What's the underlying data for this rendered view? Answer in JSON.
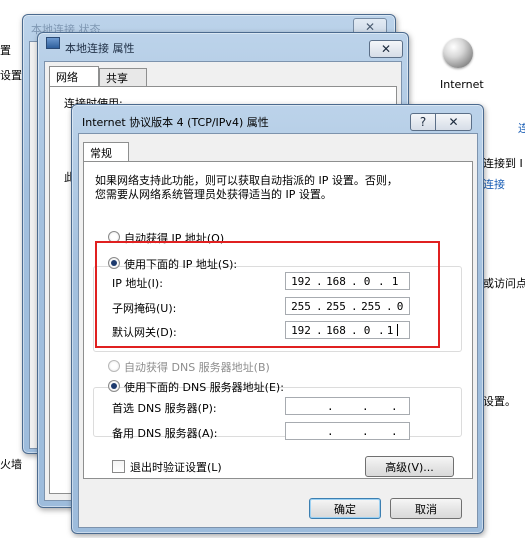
{
  "background": {
    "left_items": [
      "置",
      "设置"
    ],
    "firewall_text": "火墙",
    "internet_label": "Internet",
    "right_link_top": "连",
    "connect_to_text": "连接到 I",
    "connect_link": "连接",
    "or_visit_text": "或访问点",
    "settings_text": "设置。"
  },
  "back_window": {
    "title": "本地连接 状态",
    "close_label": "✕"
  },
  "mid_window": {
    "title": "本地连接 属性",
    "close_label": "✕",
    "tabs": [
      "网络",
      "共享"
    ],
    "connect_using_label": "连接时使用:",
    "side_label": "此"
  },
  "front_window": {
    "title": "Internet 协议版本 4 (TCP/IPv4) 属性",
    "help_label": "?",
    "close_label": "✕",
    "tab_general": "常规",
    "description_line1": "如果网络支持此功能，则可以获取自动指派的 IP 设置。否则，",
    "description_line2": "您需要从网络系统管理员处获得适当的 IP 设置。",
    "auto_ip_label": "自动获得 IP 地址(O)",
    "manual_ip_label": "使用下面的 IP 地址(S):",
    "ip_address_label": "IP 地址(I):",
    "subnet_label": "子网掩码(U):",
    "gateway_label": "默认网关(D):",
    "ip_address": [
      "192",
      "168",
      "0",
      "1"
    ],
    "subnet_mask": [
      "255",
      "255",
      "255",
      "0"
    ],
    "gateway": [
      "192",
      "168",
      "0",
      "1"
    ],
    "auto_dns_label": "自动获得 DNS 服务器地址(B)",
    "manual_dns_label": "使用下面的 DNS 服务器地址(E):",
    "preferred_dns_label": "首选 DNS 服务器(P):",
    "alternate_dns_label": "备用 DNS 服务器(A):",
    "dot": ".",
    "validate_label": "退出时验证设置(L)",
    "advanced_button": "高级(V)...",
    "ok_button": "确定",
    "cancel_button": "取消"
  },
  "colors": {
    "highlight_box": "#e02020",
    "frame_blue": "#a3c0de",
    "link_blue": "#1a5eb5"
  }
}
